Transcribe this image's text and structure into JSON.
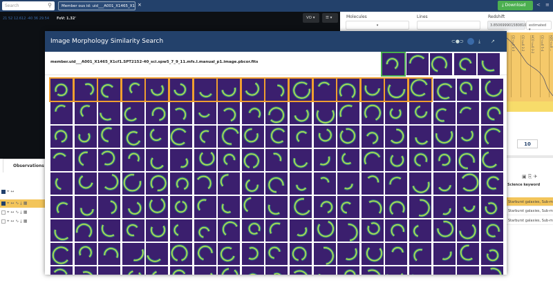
{
  "topbar": {
    "search_placeholder": "Search",
    "tab_label": "Member ous id: uid___A001_X1465_X1c...",
    "close": "×",
    "download": "⤓ Download",
    "share": "<",
    "menu": "≡"
  },
  "viewer": {
    "coords": "21 52 12.612 -40 36 29.54",
    "fov": "FoV: 1.32'",
    "vo": "VO ▾",
    "layers": "☰ ▾"
  },
  "filters": {
    "molecules_label": "Molecules",
    "molecules_value": "▾",
    "lines_label": "Lines",
    "lines_value": "",
    "redshift_label": "Redshift",
    "redshift_value": "3.850699901580810",
    "redshift_mode": "estimated ▾"
  },
  "spectrum": {
    "line_labels": [
      "CO v=0 4-3",
      "CO v=0 3-2",
      "HCO v=0 3-2",
      "CO v=0 5-4",
      "H2O v=0 ..."
    ],
    "zoom_value": "10"
  },
  "observations": {
    "tab": "Observations",
    "rows": [
      {
        "checked": true,
        "icons": "⌖ ↔"
      },
      {
        "checked": true,
        "icons": "⌖ ↔ ∿ ⤓ ▦"
      },
      {
        "checked": false,
        "icons": "⌖ ↔ ∿ ⤓ ▦"
      },
      {
        "checked": false,
        "icons": "⌖ ↔ ∿ ⤓ ▦"
      }
    ]
  },
  "science": {
    "header": "Science keyword",
    "rows": [
      "Starburst galaxies, Sub-mm",
      "Starburst galaxies, Sub-mm",
      "Starburst galaxies, Sub-mm"
    ]
  },
  "modal": {
    "title": "Image Morphology Similarity Search",
    "filename": "member.uid___A001_X1465_X1cf1.SPT2152-40_sci.spw5_7_9_11.mfs.I.manual_p1.image.pbcor.fits",
    "icons": [
      "toggle-icon",
      "similarity-icon",
      "download-icon",
      "external-link-icon"
    ],
    "highlighted_count": 16,
    "colors": {
      "accent": "#f0a030",
      "selected": "#4caf50",
      "thumb_bg": "#3b1f6e",
      "ring": "#b8e04a"
    }
  }
}
